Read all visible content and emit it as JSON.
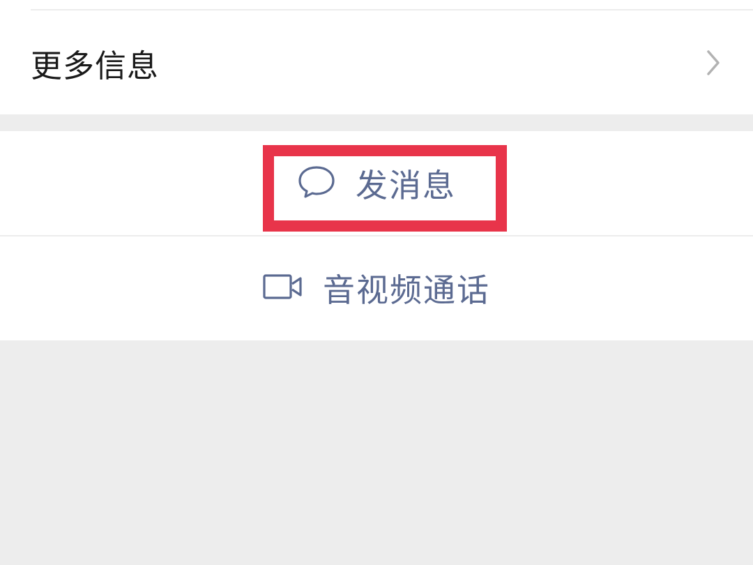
{
  "more_info": {
    "label": "更多信息",
    "chevron_icon": "chevron-right-icon"
  },
  "actions": {
    "send_message": {
      "label": "发消息",
      "icon": "chat-bubble-icon"
    },
    "av_call": {
      "label": "音视频通话",
      "icon": "video-camera-icon"
    }
  },
  "colors": {
    "action_text": "#5b6a91",
    "highlight": "#e8344a",
    "background": "#ededed",
    "card": "#ffffff"
  }
}
